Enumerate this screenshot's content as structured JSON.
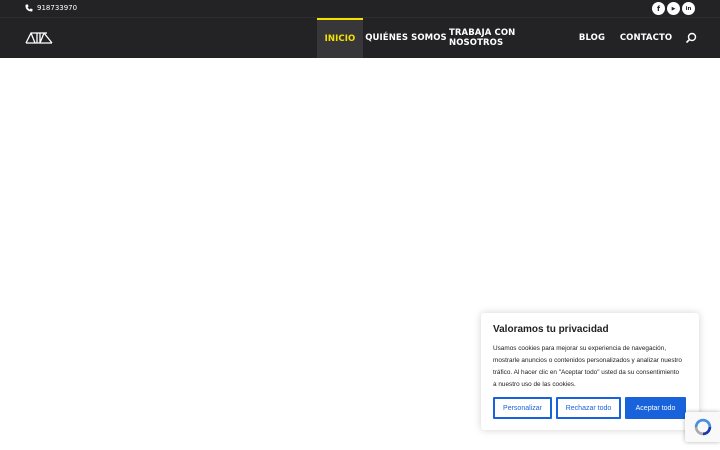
{
  "topbar": {
    "phone": "918733970",
    "socials": [
      {
        "icon": "facebook-icon",
        "glyph": "f"
      },
      {
        "icon": "youtube-icon",
        "glyph": "▶"
      },
      {
        "icon": "linkedin-icon",
        "glyph": "in"
      }
    ]
  },
  "nav": {
    "items": [
      {
        "label": "INICIO",
        "active": true
      },
      {
        "label": "QUIÉNES SOMOS",
        "active": false
      },
      {
        "label": "TRABAJA CON NOSOTROS",
        "active": false
      },
      {
        "label": "BLOG",
        "active": false
      },
      {
        "label": "CONTACTO",
        "active": false
      }
    ]
  },
  "cookie": {
    "title": "Valoramos tu privacidad",
    "text": "Usamos cookies para mejorar su experiencia de navegación, mostrarle anuncios o contenidos personalizados y analizar nuestro tráfico. Al hacer clic en \"Aceptar todo\" usted da su consentimiento a nuestro uso de las cookies.",
    "customize_label": "Personalizar",
    "reject_label": "Rechazar todo",
    "accept_label": "Aceptar todo"
  },
  "colors": {
    "header_bg": "#232325",
    "accent": "#f5e100",
    "button_blue": "#1863dc"
  }
}
